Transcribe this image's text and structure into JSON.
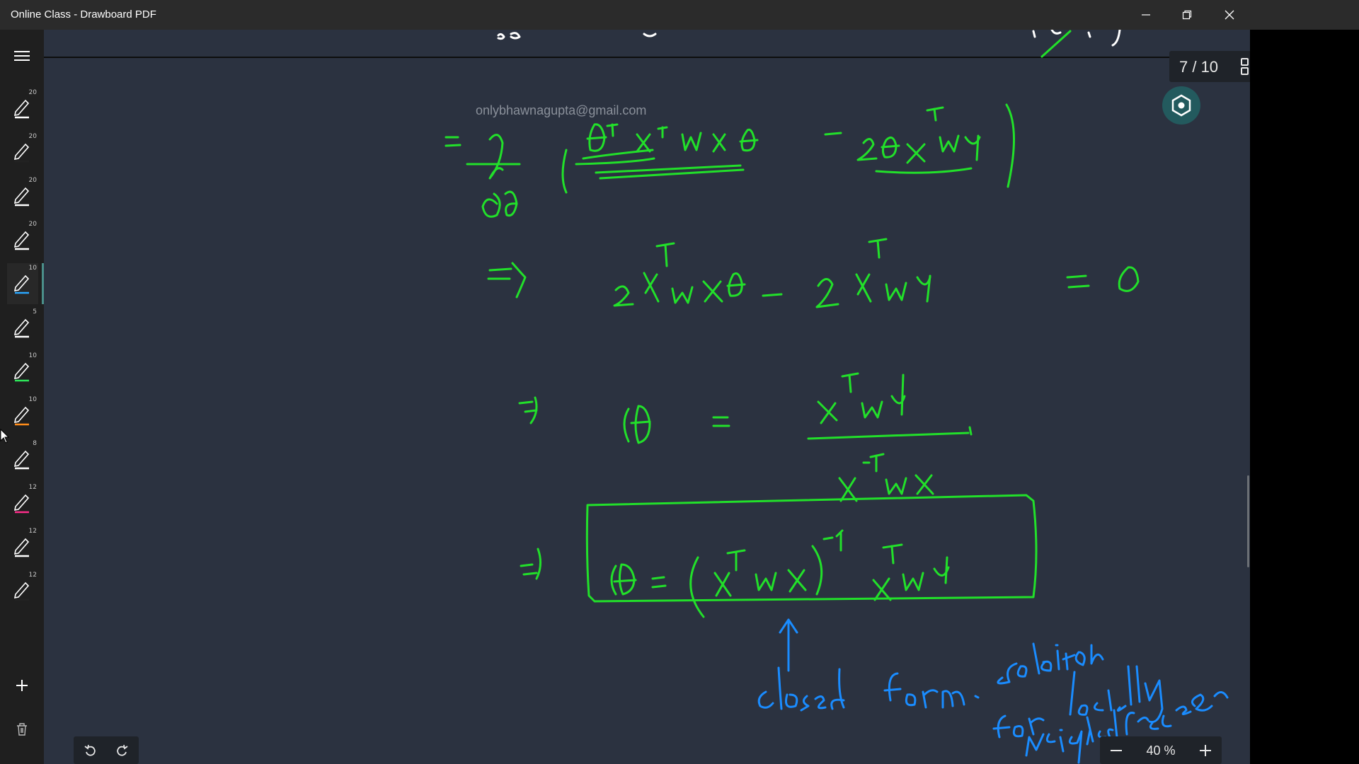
{
  "window": {
    "title": "Online Class - Drawboard PDF",
    "controls": [
      "minimize-icon",
      "restore-icon",
      "close-icon"
    ]
  },
  "sidebar": {
    "menu_icon": "hamburger-menu-icon",
    "pens": [
      {
        "size": "20",
        "color": "#ffffff"
      },
      {
        "size": "20",
        "color": "#222222"
      },
      {
        "size": "20",
        "color": "#ffffff"
      },
      {
        "size": "20",
        "color": "#ffffff"
      },
      {
        "size": "10",
        "color": "#2aa7ff",
        "active": true
      },
      {
        "size": "5",
        "color": "#ffffff"
      },
      {
        "size": "10",
        "color": "#2ee85a"
      },
      {
        "size": "10",
        "color": "#ff8c1a"
      },
      {
        "size": "8",
        "color": "#ffffff"
      },
      {
        "size": "12",
        "color": "#ff2d8a"
      },
      {
        "size": "12",
        "color": "#ffffff"
      },
      {
        "size": "12",
        "color": "#222222"
      }
    ],
    "add_icon": "plus-icon",
    "delete_icon": "trash-icon"
  },
  "document": {
    "watermark_email": "onlybhawnagupta@gmail.com",
    "ink_colors": {
      "green": "#22e02a",
      "blue": "#1a8cff"
    }
  },
  "page_counter": {
    "text": "7 / 10",
    "current": 7,
    "total": 10,
    "grid_icon": "page-grid-icon"
  },
  "pen_settings_icon": "hexagon-settings-icon",
  "history": {
    "undo_icon": "undo-icon",
    "redo_icon": "redo-icon"
  },
  "zoom": {
    "value": "40 %",
    "minus_icon": "zoom-out-icon",
    "plus_icon": "zoom-in-icon"
  }
}
